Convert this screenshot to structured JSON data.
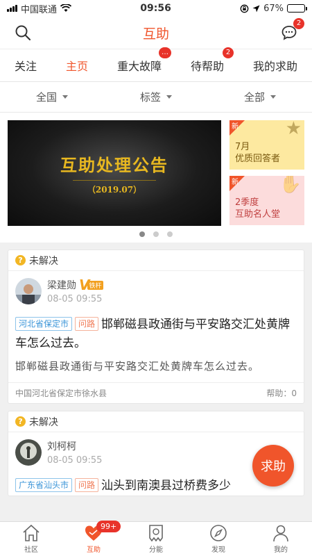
{
  "status": {
    "carrier": "中国联通",
    "time": "09:56",
    "battery": "67%",
    "battery_level": 0.67
  },
  "nav": {
    "title": "互助",
    "message_count": "2"
  },
  "tabs": [
    {
      "label": "关注"
    },
    {
      "label": "主页"
    },
    {
      "label": "重大故障",
      "badge": "…"
    },
    {
      "label": "待帮助",
      "badge": "2"
    },
    {
      "label": "我的求助"
    }
  ],
  "filters": [
    {
      "label": "全国"
    },
    {
      "label": "标签"
    },
    {
      "label": "全部"
    }
  ],
  "banner": {
    "title": "互助处理公告",
    "subtitle": "（2019.07）",
    "cards": [
      {
        "corner": "新",
        "line1": "7月",
        "line2": "优质回答者"
      },
      {
        "corner": "新",
        "line1": "2季度",
        "line2": "互助名人堂"
      }
    ]
  },
  "posts": [
    {
      "status": "未解决",
      "author": "梁建勋",
      "verified": "铁杆",
      "date": "08-05 09:55",
      "tag_location": "河北省保定市",
      "tag_category": "问路",
      "title": "邯郸磁县政通街与平安路交汇处黄牌车怎么过去。",
      "body": "邯郸磁县政通街与平安路交汇处黄牌车怎么过去。",
      "location": "中国河北省保定市徐水县",
      "help_label": "帮助：",
      "help_count": "0"
    },
    {
      "status": "未解决",
      "author": "刘柯柯",
      "date": "08-05 09:55",
      "tag_location": "广东省汕头市",
      "tag_category": "问路",
      "title": "汕头到南澳县过桥费多少"
    }
  ],
  "fab": {
    "label": "求助"
  },
  "tabbar": [
    {
      "label": "社区",
      "icon": "home-icon"
    },
    {
      "label": "互助",
      "icon": "heart-hands-icon",
      "badge": "99+"
    },
    {
      "label": "分能",
      "icon": "score-icon"
    },
    {
      "label": "发现",
      "icon": "compass-icon"
    },
    {
      "label": "我的",
      "icon": "person-icon"
    }
  ],
  "colors": {
    "accent": "#f0552b",
    "badge": "#e8332a",
    "tag_location": "#3a94d8",
    "tag_category": "#f07a55"
  }
}
